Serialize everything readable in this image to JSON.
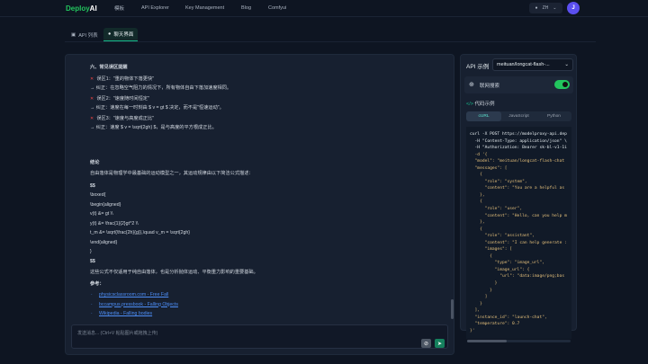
{
  "nav": {
    "logo_a": "Deploy",
    "logo_b": "AI",
    "links": [
      "模板",
      "API Explorer",
      "Key Management",
      "Blog",
      "Comfyui"
    ],
    "lang": "ZH",
    "avatar": "J"
  },
  "tabs": [
    "API 列表",
    "聊天界面"
  ],
  "message": {
    "heading": "六、常见误区提醒",
    "mistakes": [
      {
        "wrong": "误区1：\"重的物体下落更快\"",
        "fix": "→ 纠正：在忽略空气阻力的情况下，所有物体自由下落加速度相同。"
      },
      {
        "wrong": "误区2：\"速度随时间恒定\"",
        "fix": "→ 纠正：速度在每一时刻由 $ v = gt $ 决定，而不是\"恒速运动\"。"
      },
      {
        "wrong": "误区3：\"速度与高度成正比\"",
        "fix": "→ 纠正：速度 $ v = \\sqrt{2gh} $，是与高度的平方根成正比。"
      }
    ],
    "summary_title": "结论",
    "summary": "自由落体是物理学中最基础的运动模型之一，其运动规律由以下简洁公式描述：",
    "formula": [
      "$$",
      "\\boxed{",
      "\\begin{aligned}",
      "v(t) &= gt \\\\",
      "y(t) &= \\frac{1}{2}gt^2 \\\\",
      "t_m &= \\sqrt{\\frac{2h}{g}},\\quad v_m = \\sqrt{2gh}",
      "\\end{aligned}",
      "}",
      "$$"
    ],
    "closing": "这些公式不仅适用于纯自由落体，也是分析抛体运动、平衡重力影响的重要基础。",
    "refs_title": "参考：",
    "refs": [
      "physicsclassroom.com - Free Fall",
      "bccampus.pressbook - Falling Objects",
      "Wikipedia - Falling bodies"
    ]
  },
  "input": {
    "placeholder": "发送消息... (Ctrl+V 粘贴图片或拖拽上传)"
  },
  "side": {
    "api_label": "API 示例",
    "model": "meituan/longcat-flash-...",
    "web_search": "联网搜索",
    "web_search_on": true,
    "code_title": "代码示例",
    "langs": [
      "cURL",
      "JavaScript",
      "Python"
    ],
    "code": [
      "curl -X POST https://modelproxy-api.dep",
      "  -H \"Content-Type: application/json\" \\",
      "  -H \"Authorization: Bearer sk-bl-v1-1i",
      "  -d '{",
      "  \"model\": \"meituan/longcat-flash-chat",
      "  \"messages\": [",
      "    {",
      "      \"role\": \"system\",",
      "      \"content\": \"You are a helpful as",
      "    },",
      "    {",
      "      \"role\": \"user\",",
      "      \"content\": \"Hello, can you help m",
      "    },",
      "    {",
      "      \"role\": \"assistant\",",
      "      \"content\": \"I can help generate :",
      "      \"images\": [",
      "        {",
      "          \"type\": \"image_url\",",
      "          \"image_url\": {",
      "            \"url\": \"data:image/png;bas",
      "          }",
      "        }",
      "      ]",
      "    }",
      "  ],",
      "  \"instance_id\": \"launch-chat\",",
      "  \"temperature\": 0.7",
      "}'"
    ]
  }
}
